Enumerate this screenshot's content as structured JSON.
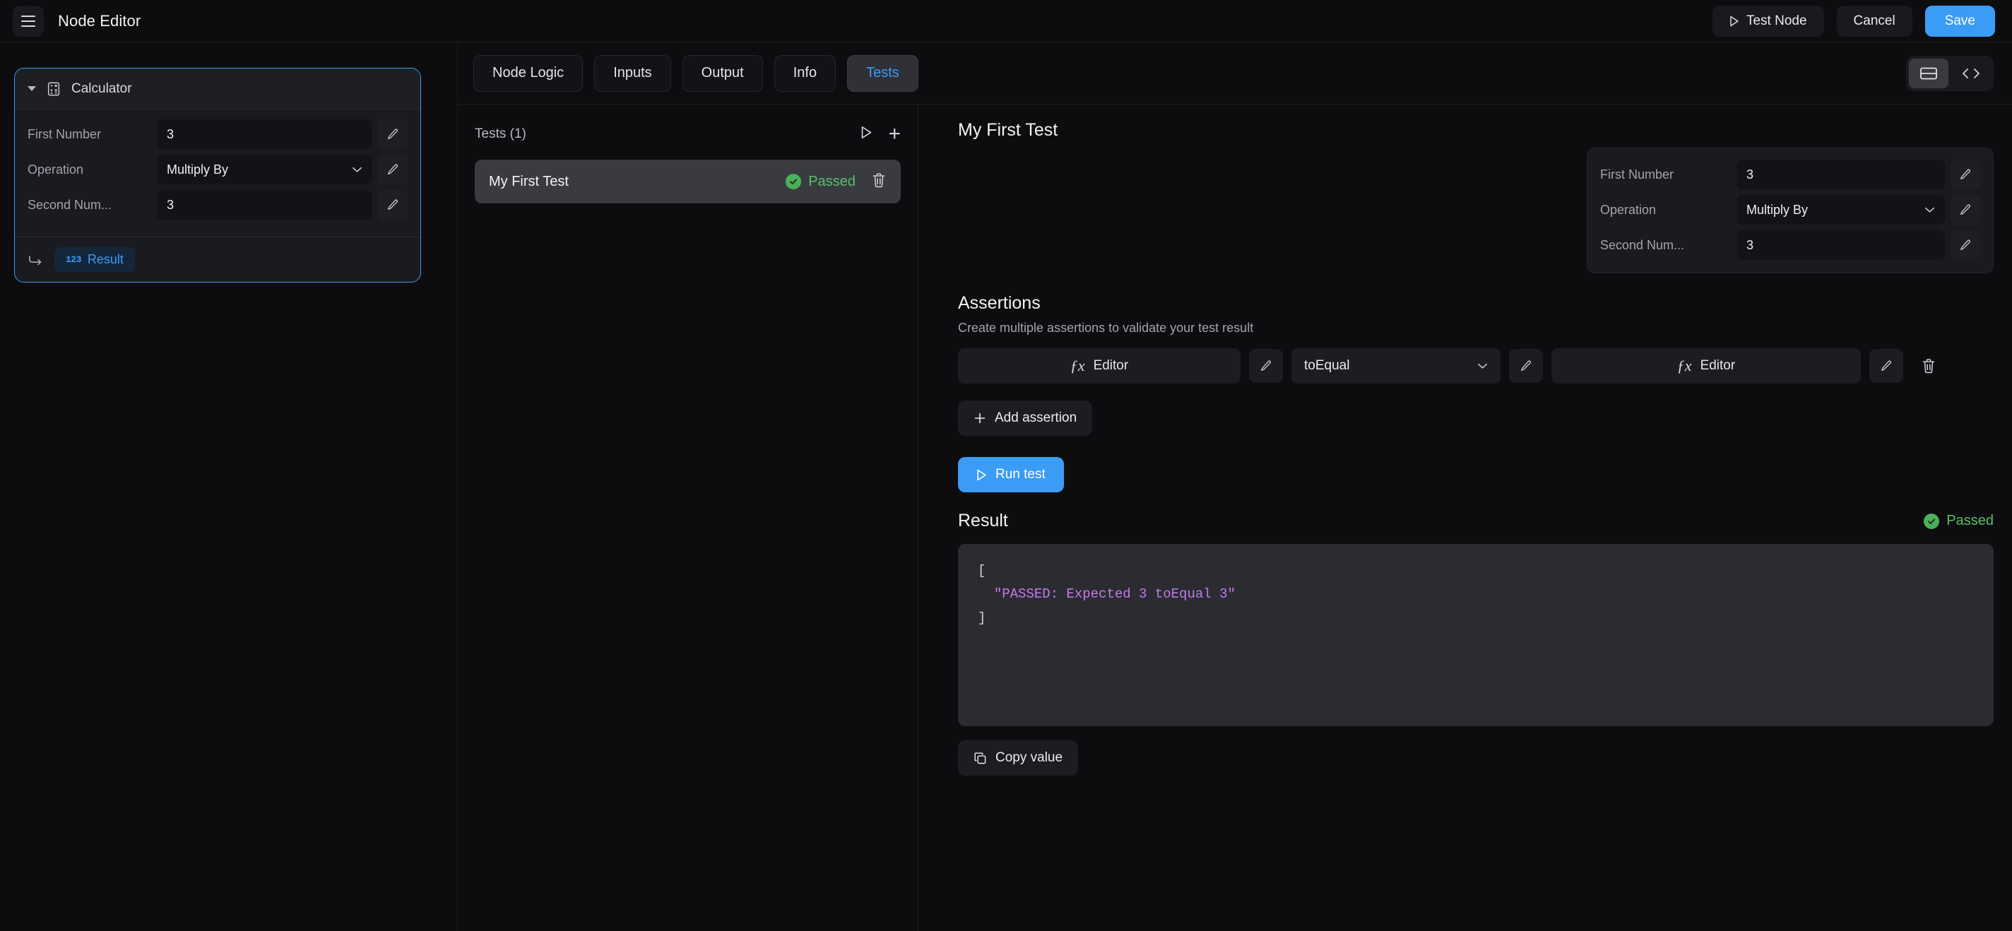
{
  "app": {
    "title": "Node Editor",
    "menu_icon": "hamburger-icon"
  },
  "topbar": {
    "test_node_label": "Test Node",
    "cancel_label": "Cancel",
    "save_label": "Save",
    "accent_color": "#3b9cf5"
  },
  "node_panel": {
    "title": "Calculator",
    "icon": "calculator-icon",
    "fields": [
      {
        "label": "First Number",
        "value": "3",
        "type": "text"
      },
      {
        "label": "Operation",
        "value": "Multiply By",
        "type": "select"
      },
      {
        "label": "Second Num...",
        "value": "3",
        "type": "text"
      }
    ],
    "output": {
      "label": "Result",
      "badge": "123"
    },
    "edit_icon": "pencil-icon",
    "selected_border_color": "#3b9cf5"
  },
  "tabs": [
    {
      "label": "Node Logic",
      "active": false
    },
    {
      "label": "Inputs",
      "active": false
    },
    {
      "label": "Output",
      "active": false
    },
    {
      "label": "Info",
      "active": false
    },
    {
      "label": "Tests",
      "active": true
    }
  ],
  "view_toggle": {
    "split_view": "split-view-icon",
    "code_view": "code-view-icon",
    "active": "split_view"
  },
  "tests_panel": {
    "header_label": "Tests (1)",
    "run_all_icon": "play-icon",
    "add_icon": "plus-icon",
    "items": [
      {
        "name": "My First Test",
        "status": "Passed",
        "status_color": "#5bbd6a",
        "delete_icon": "trash-icon"
      }
    ]
  },
  "detail": {
    "title": "My First Test",
    "inputs": [
      {
        "label": "First Number",
        "value": "3",
        "type": "text"
      },
      {
        "label": "Operation",
        "value": "Multiply By",
        "type": "select"
      },
      {
        "label": "Second Num...",
        "value": "3",
        "type": "text"
      }
    ],
    "assertions": {
      "title": "Assertions",
      "subtitle": "Create multiple assertions to validate your test result",
      "rows": [
        {
          "left_expr": "Editor",
          "operator": "toEqual",
          "right_expr": "Editor",
          "fx_icon": "function-icon",
          "edit_icon": "pencil-icon",
          "delete_icon": "trash-icon"
        }
      ],
      "add_label": "Add assertion",
      "add_icon": "plus-icon"
    },
    "run_test_label": "Run test",
    "run_test_icon": "play-icon",
    "result": {
      "title": "Result",
      "status": "Passed",
      "status_color": "#5bbd6a",
      "code_open": "[",
      "code_line": "\"PASSED: Expected 3 toEqual 3\"",
      "code_close": "]",
      "copy_label": "Copy value",
      "copy_icon": "copy-icon"
    }
  }
}
